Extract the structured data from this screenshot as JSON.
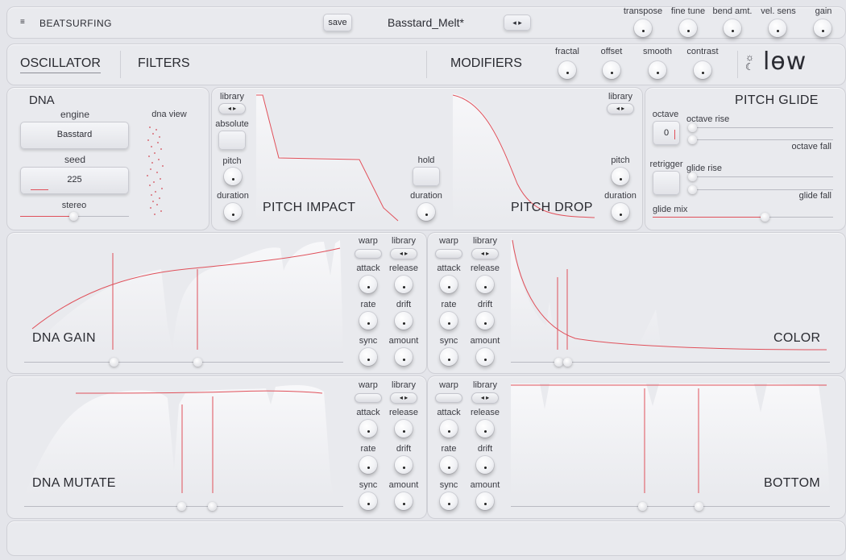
{
  "header": {
    "brand": "BEATSURFING",
    "menu_icon": "hamburger-icon",
    "save_label": "save",
    "preset_name": "Basstard_Melt*",
    "preset_arrows": "◂ ▸",
    "knobs": [
      "transpose",
      "fine tune",
      "bend amt.",
      "vel. sens",
      "gain"
    ]
  },
  "nav": {
    "tabs": [
      "OSCILLATOR",
      "FILTERS",
      "MODIFIERS"
    ],
    "active_tab": "OSCILLATOR",
    "modifier_knobs": [
      "fractal",
      "offset",
      "smooth",
      "contrast"
    ],
    "logo_text": "lѳw",
    "theme_icon": "sun-moon-icon"
  },
  "dna": {
    "title": "DNA",
    "engine_label": "engine",
    "engine_value": "Basstard",
    "seed_label": "seed",
    "seed_value": "225",
    "stereo_label": "stereo",
    "dna_view_label": "dna view"
  },
  "pitch_impact": {
    "title": "PITCH IMPACT",
    "library_label": "library",
    "absolute_label": "absolute",
    "pitch_label": "pitch",
    "duration_label": "duration"
  },
  "hold": {
    "hold_label": "hold",
    "duration_label": "duration"
  },
  "pitch_drop": {
    "title": "PITCH DROP",
    "library_label": "library",
    "pitch_label": "pitch",
    "duration_label": "duration"
  },
  "pitch_glide": {
    "title": "PITCH GLIDE",
    "octave_label": "octave",
    "octave_value": "0",
    "octave_rise": "octave rise",
    "octave_fall": "octave fall",
    "retrigger_label": "retrigger",
    "glide_rise": "glide rise",
    "glide_fall": "glide fall",
    "glide_mix": "glide mix"
  },
  "modulators": [
    {
      "title": "DNA GAIN"
    },
    {
      "title": "COLOR"
    },
    {
      "title": "DNA MUTATE"
    },
    {
      "title": "BOTTOM"
    }
  ],
  "mod_controls": {
    "warp": "warp",
    "library": "library",
    "attack": "attack",
    "release": "release",
    "rate": "rate",
    "drift": "drift",
    "sync": "sync",
    "amount": "amount"
  },
  "colors": {
    "accent": "#e0505a",
    "background": "#e4e5ea",
    "panel": "#e9eaee"
  }
}
